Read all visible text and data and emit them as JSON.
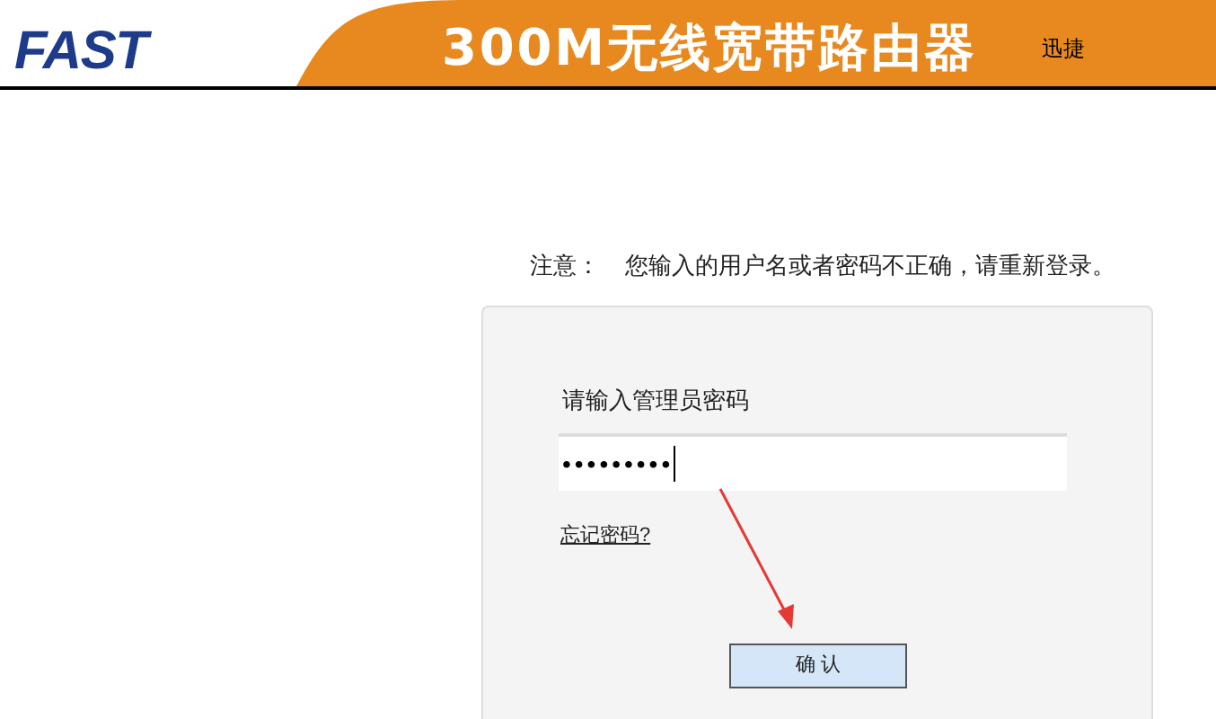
{
  "header": {
    "logo": "FAST",
    "title": "300M无线宽带路由器",
    "subtitle": "迅捷"
  },
  "notice": {
    "label": "注意：",
    "message": "您输入的用户名或者密码不正确，请重新登录。"
  },
  "login": {
    "prompt": "请输入管理员密码",
    "password": "•••••••••",
    "forgot_link": "忘记密码?",
    "confirm_button": "确 认"
  }
}
